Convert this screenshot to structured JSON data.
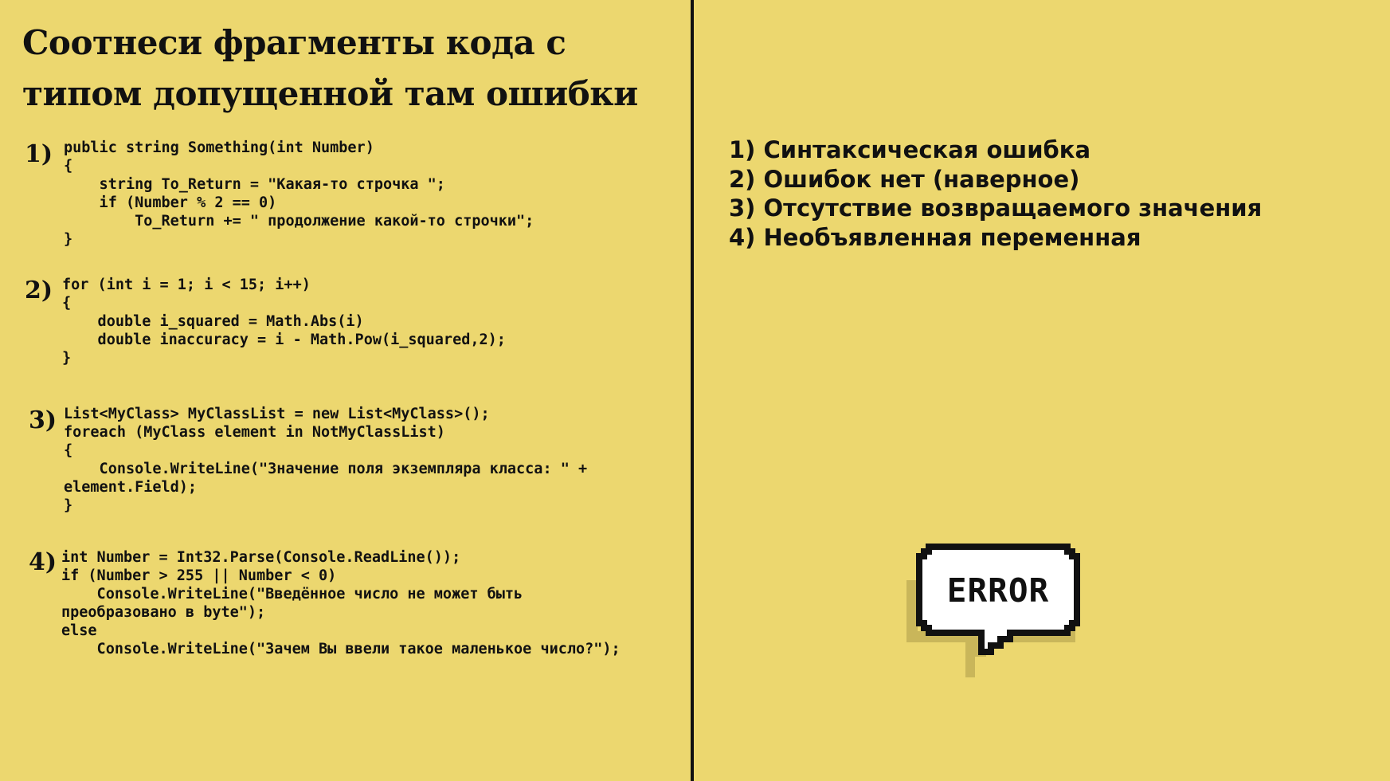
{
  "title": "Соотнеси фрагменты кода с типом допущенной там ошибки",
  "snippets": [
    {
      "number": "1)",
      "code": "public string Something(int Number)\n{\n    string To_Return = \"Какая-то строчка \";\n    if (Number % 2 == 0)\n        To_Return += \" продолжение какой-то строчки\";\n}"
    },
    {
      "number": "2)",
      "code": "for (int i = 1; i < 15; i++)\n{\n    double i_squared = Math.Abs(i)\n    double inaccuracy = i - Math.Pow(i_squared,2);\n}"
    },
    {
      "number": "3)",
      "code": "List<MyClass> MyClassList = new List<MyClass>();\nforeach (MyClass element in NotMyClassList)\n{\n    Console.WriteLine(\"Значение поля экземпляра класса: \" +\nelement.Field);\n}"
    },
    {
      "number": "4)",
      "code": "int Number = Int32.Parse(Console.ReadLine());\nif (Number > 255 || Number < 0)\n    Console.WriteLine(\"Введённое число не может быть\nпреобразовано в byte\");\nelse\n    Console.WriteLine(\"Зачем Вы ввели такое маленькое число?\");"
    }
  ],
  "answers": [
    "1) Синтаксическая ошибка",
    "2) Ошибок нет (наверное)",
    "3) Отсутствие возвращаемого значения",
    "4) Необъявленная переменная"
  ],
  "bubble_text": "ERROR",
  "colors": {
    "background": "#ecd76f",
    "text": "#111111",
    "bubble_shadow": "#c9b65a"
  }
}
